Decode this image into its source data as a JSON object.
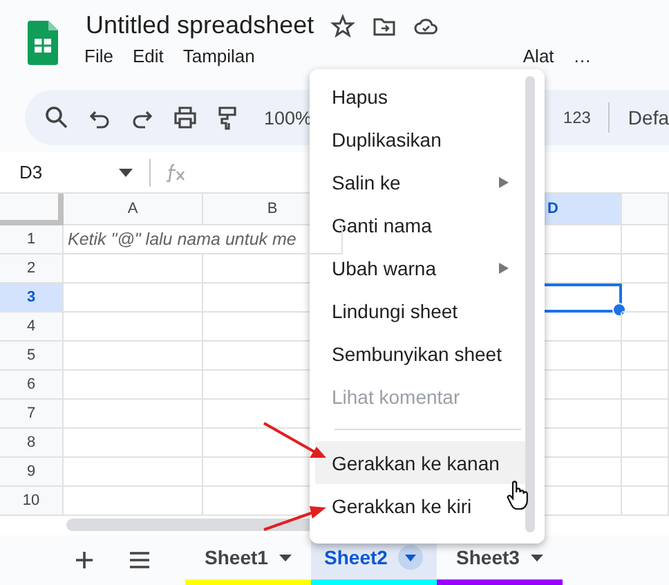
{
  "app": {
    "title": "Untitled spreadsheet",
    "menus": [
      "File",
      "Edit",
      "Tampilan",
      "Alat",
      "…"
    ]
  },
  "toolbar": {
    "zoom": "100%",
    "number_format": "123",
    "font": "Defa"
  },
  "formula_bar": {
    "cell_ref": "D3"
  },
  "sheet": {
    "columns": [
      {
        "label": "A",
        "selected": false
      },
      {
        "label": "B",
        "selected": false
      },
      {
        "label": "D",
        "selected": true
      }
    ],
    "rows": [
      {
        "number": "1",
        "selected": false,
        "cell_a": "Ketik \"@\" lalu nama untuk me"
      },
      {
        "number": "2",
        "selected": false
      },
      {
        "number": "3",
        "selected": true
      },
      {
        "number": "4",
        "selected": false
      },
      {
        "number": "5",
        "selected": false
      },
      {
        "number": "6",
        "selected": false
      },
      {
        "number": "7",
        "selected": false
      },
      {
        "number": "8",
        "selected": false
      },
      {
        "number": "9",
        "selected": false
      },
      {
        "number": "10",
        "selected": false
      }
    ]
  },
  "sheet_tabs": [
    {
      "label": "Sheet1",
      "selected": false,
      "color": "#ffff00"
    },
    {
      "label": "Sheet2",
      "selected": true,
      "color": "#00ffff"
    },
    {
      "label": "Sheet3",
      "selected": false,
      "color": "#9900ff"
    }
  ],
  "context_menu": [
    {
      "kind": "item",
      "label": "Hapus",
      "submenu": false,
      "disabled": false,
      "hovered": false
    },
    {
      "kind": "item",
      "label": "Duplikasikan",
      "submenu": false,
      "disabled": false,
      "hovered": false
    },
    {
      "kind": "item",
      "label": "Salin ke",
      "submenu": true,
      "disabled": false,
      "hovered": false
    },
    {
      "kind": "item",
      "label": "Ganti nama",
      "submenu": false,
      "disabled": false,
      "hovered": false
    },
    {
      "kind": "item",
      "label": "Ubah warna",
      "submenu": true,
      "disabled": false,
      "hovered": false
    },
    {
      "kind": "item",
      "label": "Lindungi sheet",
      "submenu": false,
      "disabled": false,
      "hovered": false
    },
    {
      "kind": "item",
      "label": "Sembunyikan sheet",
      "submenu": false,
      "disabled": false,
      "hovered": false
    },
    {
      "kind": "item",
      "label": "Lihat komentar",
      "submenu": false,
      "disabled": true,
      "hovered": false
    },
    {
      "kind": "separator"
    },
    {
      "kind": "item",
      "label": "Gerakkan ke kanan",
      "submenu": false,
      "disabled": false,
      "hovered": true
    },
    {
      "kind": "item",
      "label": "Gerakkan ke kiri",
      "submenu": false,
      "disabled": false,
      "hovered": false
    }
  ]
}
